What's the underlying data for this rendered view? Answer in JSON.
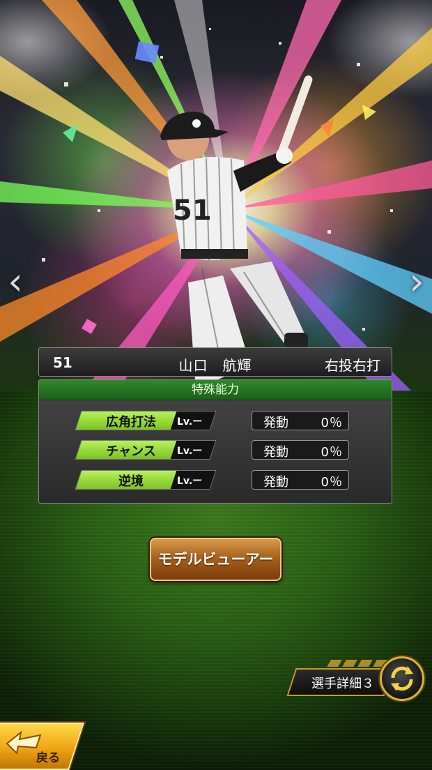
{
  "player": {
    "number": "51",
    "name": "山口　航輝",
    "handedness": "右投右打"
  },
  "abilities": {
    "header": "特殊能力",
    "items": [
      {
        "name": "広角打法",
        "level_prefix": "Lv.",
        "level": "ー",
        "activation_label": "発動",
        "activation_rate": "0％"
      },
      {
        "name": "チャンス",
        "level_prefix": "Lv.",
        "level": "ー",
        "activation_label": "発動",
        "activation_rate": "0％"
      },
      {
        "name": "逆境",
        "level_prefix": "Lv.",
        "level": "ー",
        "activation_label": "発動",
        "activation_rate": "0％"
      }
    ]
  },
  "buttons": {
    "model_viewer": "モデルビューアー",
    "player_detail": "選手詳細３",
    "back": "戻る"
  },
  "icons": {
    "prev": "chevron-left-icon",
    "next": "chevron-right-icon",
    "switch": "switch-arrows-icon",
    "back": "back-arrow-icon"
  },
  "colors": {
    "ability_fill": "#9ad63c",
    "header_green": "#2a7a24",
    "button_brown": "#a8621e",
    "gold": "#d8b23a"
  }
}
